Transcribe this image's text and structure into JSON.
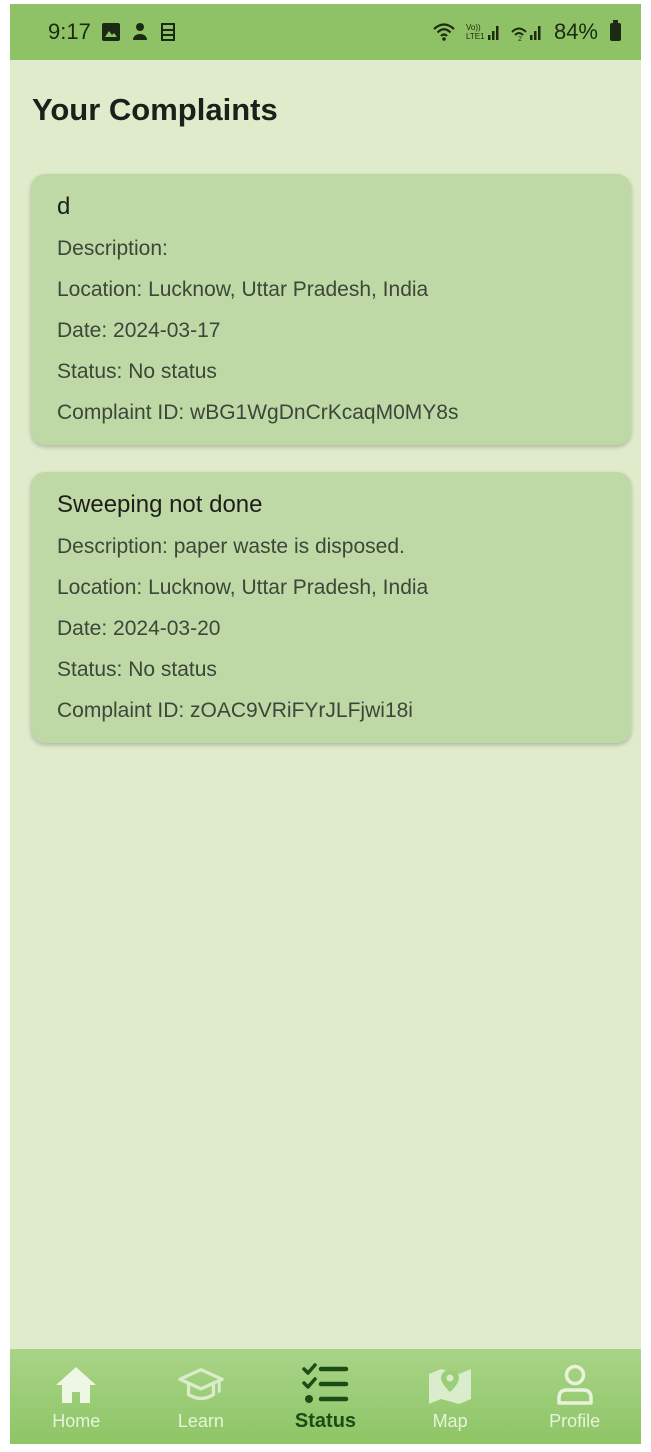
{
  "status_bar": {
    "time": "9:17",
    "battery": "84%",
    "icons_left": [
      "gallery-icon",
      "notification-icon",
      "sim-app-icon"
    ],
    "icons_right": [
      "wifi-icon",
      "volte-signal-icon",
      "signal-icon",
      "battery-icon"
    ],
    "volte_label": "Vo))\nLTE1"
  },
  "page": {
    "title": "Your Complaints"
  },
  "complaints": [
    {
      "title": "d",
      "description": "Description:",
      "location": "Location: Lucknow, Uttar Pradesh, India",
      "date": "Date: 2024-03-17",
      "status": "Status: No status",
      "complaint_id": "Complaint ID: wBG1WgDnCrKcaqM0MY8s"
    },
    {
      "title": "Sweeping not done",
      "description": "Description: paper waste is disposed.",
      "location": "Location: Lucknow, Uttar Pradesh, India",
      "date": "Date: 2024-03-20",
      "status": "Status: No status",
      "complaint_id": "Complaint ID: zOAC9VRiFYrJLFjwi18i"
    }
  ],
  "bottom_nav": {
    "items": [
      {
        "label": "Home",
        "icon": "home-icon",
        "active": false
      },
      {
        "label": "Learn",
        "icon": "graduation-cap-icon",
        "active": false
      },
      {
        "label": "Status",
        "icon": "checklist-icon",
        "active": true
      },
      {
        "label": "Map",
        "icon": "map-icon",
        "active": false
      },
      {
        "label": "Profile",
        "icon": "profile-icon",
        "active": false
      }
    ]
  },
  "colors": {
    "background": "#dfebcb",
    "status_bar": "#8fc266",
    "card": "#bfd9a6",
    "nav_active": "#1b4d16",
    "nav_inactive": "#e9f3dc"
  }
}
